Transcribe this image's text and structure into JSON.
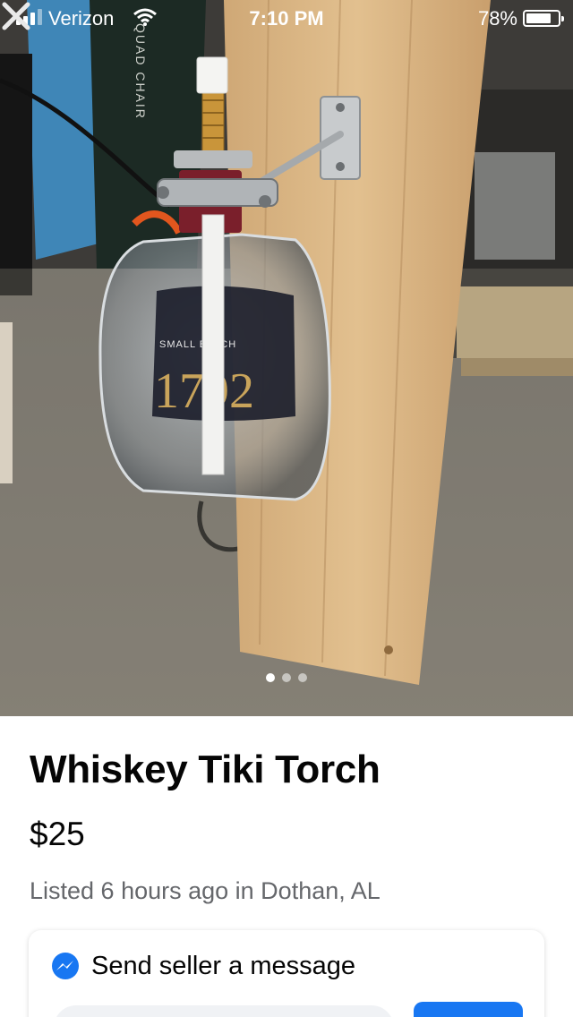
{
  "status_bar": {
    "carrier": "Verizon",
    "time": "7:10 PM",
    "battery": "78%",
    "battery_level": 0.78
  },
  "photo": {
    "bottle_label_top": "SMALL BATCH",
    "bottle_label_number": "1792",
    "chair_text": "QUAD CHAIR",
    "image_count": 3,
    "current_image": 1
  },
  "listing": {
    "title": "Whiskey Tiki Torch",
    "price": "$25",
    "listed": "Listed 6 hours ago in Dothan, AL"
  },
  "message": {
    "heading": "Send seller a message",
    "input_value": "",
    "send_label": ""
  },
  "colors": {
    "accent": "#1877f2",
    "secondary_text": "#65676b"
  },
  "icons": {
    "close": "close-icon",
    "messenger": "messenger-icon",
    "wifi": "wifi-icon",
    "signal": "signal-icon",
    "battery": "battery-icon"
  }
}
